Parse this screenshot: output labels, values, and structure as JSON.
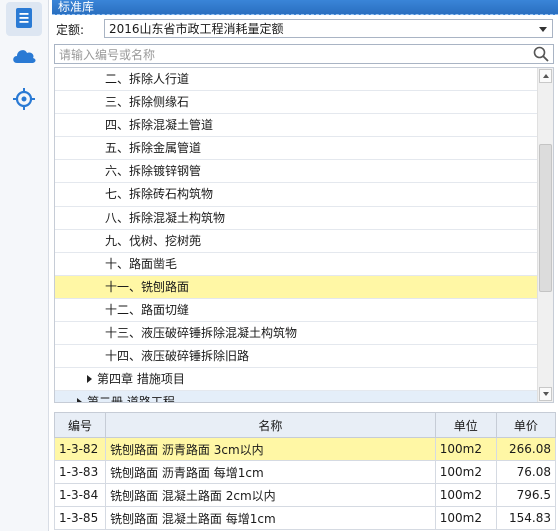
{
  "rail": {
    "items": [
      {
        "icon": "document-list-icon",
        "active": true
      },
      {
        "icon": "cloud-icon",
        "active": false
      },
      {
        "icon": "locate-target-icon",
        "active": false
      }
    ]
  },
  "panel_title": "标准库",
  "quota": {
    "label": "定额:",
    "value": "2016山东省市政工程消耗量定额"
  },
  "search": {
    "placeholder": "请输入编号或名称"
  },
  "tree": [
    {
      "label": "二、拆除人行道",
      "level": 2,
      "selected": false
    },
    {
      "label": "三、拆除侧缘石",
      "level": 2,
      "selected": false
    },
    {
      "label": "四、拆除混凝土管道",
      "level": 2,
      "selected": false
    },
    {
      "label": "五、拆除金属管道",
      "level": 2,
      "selected": false
    },
    {
      "label": "六、拆除镀锌钢管",
      "level": 2,
      "selected": false
    },
    {
      "label": "七、拆除砖石构筑物",
      "level": 2,
      "selected": false
    },
    {
      "label": "八、拆除混凝土构筑物",
      "level": 2,
      "selected": false
    },
    {
      "label": "九、伐树、挖树蔸",
      "level": 2,
      "selected": false
    },
    {
      "label": "十、路面凿毛",
      "level": 2,
      "selected": false
    },
    {
      "label": "十一、铣刨路面",
      "level": 2,
      "selected": true
    },
    {
      "label": "十二、路面切缝",
      "level": 2,
      "selected": false
    },
    {
      "label": "十三、液压破碎锤拆除混凝土构筑物",
      "level": 2,
      "selected": false
    },
    {
      "label": "十四、液压破碎锤拆除旧路",
      "level": 2,
      "selected": false
    },
    {
      "label": "第四章 措施项目",
      "level": 1,
      "selected": false
    },
    {
      "label": "第二册 道路工程",
      "level": 0,
      "selected": false
    }
  ],
  "table": {
    "headers": {
      "code": "编号",
      "name": "名称",
      "unit": "单位",
      "price": "单价"
    },
    "rows": [
      {
        "code": "1-3-82",
        "name": "铣刨路面 沥青路面 3cm以内",
        "unit": "100m2",
        "price": "266.08",
        "selected": true
      },
      {
        "code": "1-3-83",
        "name": "铣刨路面 沥青路面 每增1cm",
        "unit": "100m2",
        "price": "76.08",
        "selected": false
      },
      {
        "code": "1-3-84",
        "name": "铣刨路面 混凝土路面 2cm以内",
        "unit": "100m2",
        "price": "796.5",
        "selected": false
      },
      {
        "code": "1-3-85",
        "name": "铣刨路面 混凝土路面 每增1cm",
        "unit": "100m2",
        "price": "154.83",
        "selected": false
      }
    ]
  },
  "colors": {
    "accent": "#2a7ad4",
    "selected_row": "#fff7a5",
    "header_bg": "#e8eef6"
  }
}
